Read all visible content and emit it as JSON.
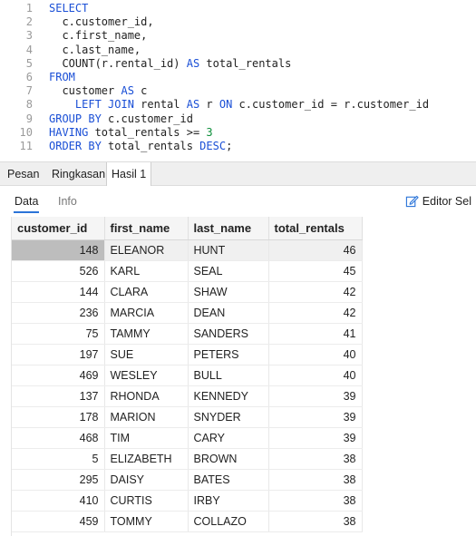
{
  "editor": {
    "lines": [
      {
        "n": "1",
        "parts": [
          {
            "t": "SELECT",
            "c": "kw"
          }
        ]
      },
      {
        "n": "2",
        "parts": [
          {
            "t": "  c.customer_id,",
            "c": ""
          }
        ]
      },
      {
        "n": "3",
        "parts": [
          {
            "t": "  c.first_name,",
            "c": ""
          }
        ]
      },
      {
        "n": "4",
        "parts": [
          {
            "t": "  c.last_name,",
            "c": ""
          }
        ]
      },
      {
        "n": "5",
        "parts": [
          {
            "t": "  COUNT(r.rental_id) ",
            "c": ""
          },
          {
            "t": "AS",
            "c": "kw"
          },
          {
            "t": " total_rentals",
            "c": ""
          }
        ]
      },
      {
        "n": "6",
        "parts": [
          {
            "t": "FROM",
            "c": "kw"
          }
        ]
      },
      {
        "n": "7",
        "parts": [
          {
            "t": "  customer ",
            "c": ""
          },
          {
            "t": "AS",
            "c": "kw"
          },
          {
            "t": " c",
            "c": ""
          }
        ]
      },
      {
        "n": "8",
        "parts": [
          {
            "t": "    ",
            "c": ""
          },
          {
            "t": "LEFT JOIN",
            "c": "kw"
          },
          {
            "t": " rental ",
            "c": ""
          },
          {
            "t": "AS",
            "c": "kw"
          },
          {
            "t": " r ",
            "c": ""
          },
          {
            "t": "ON",
            "c": "kw"
          },
          {
            "t": " c.customer_id = r.customer_id",
            "c": ""
          }
        ]
      },
      {
        "n": "9",
        "parts": [
          {
            "t": "GROUP BY",
            "c": "kw"
          },
          {
            "t": " c.customer_id",
            "c": ""
          }
        ]
      },
      {
        "n": "10",
        "parts": [
          {
            "t": "HAVING",
            "c": "kw"
          },
          {
            "t": " total_rentals >= ",
            "c": ""
          },
          {
            "t": "3",
            "c": "num"
          }
        ]
      },
      {
        "n": "11",
        "parts": [
          {
            "t": "ORDER BY",
            "c": "kw"
          },
          {
            "t": " total_rentals ",
            "c": ""
          },
          {
            "t": "DESC",
            "c": "kw"
          },
          {
            "t": ";",
            "c": ""
          }
        ]
      }
    ]
  },
  "tabs": {
    "pesan": "Pesan",
    "ringkasan": "Ringkasan",
    "hasil": "Hasil 1"
  },
  "subbar": {
    "data": "Data",
    "info": "Info",
    "editor_sel": "Editor Sel"
  },
  "grid": {
    "columns": [
      "customer_id",
      "first_name",
      "last_name",
      "total_rentals"
    ],
    "rows": [
      [
        "148",
        "ELEANOR",
        "HUNT",
        "46"
      ],
      [
        "526",
        "KARL",
        "SEAL",
        "45"
      ],
      [
        "144",
        "CLARA",
        "SHAW",
        "42"
      ],
      [
        "236",
        "MARCIA",
        "DEAN",
        "42"
      ],
      [
        "75",
        "TAMMY",
        "SANDERS",
        "41"
      ],
      [
        "197",
        "SUE",
        "PETERS",
        "40"
      ],
      [
        "469",
        "WESLEY",
        "BULL",
        "40"
      ],
      [
        "137",
        "RHONDA",
        "KENNEDY",
        "39"
      ],
      [
        "178",
        "MARION",
        "SNYDER",
        "39"
      ],
      [
        "468",
        "TIM",
        "CARY",
        "39"
      ],
      [
        "5",
        "ELIZABETH",
        "BROWN",
        "38"
      ],
      [
        "295",
        "DAISY",
        "BATES",
        "38"
      ],
      [
        "410",
        "CURTIS",
        "IRBY",
        "38"
      ],
      [
        "459",
        "TOMMY",
        "COLLAZO",
        "38"
      ]
    ]
  },
  "colors": {
    "keyword": "#1a4fd6",
    "number": "#0d8f3a",
    "accent": "#2b74d8",
    "selected_cell": "#bdbdbd"
  }
}
